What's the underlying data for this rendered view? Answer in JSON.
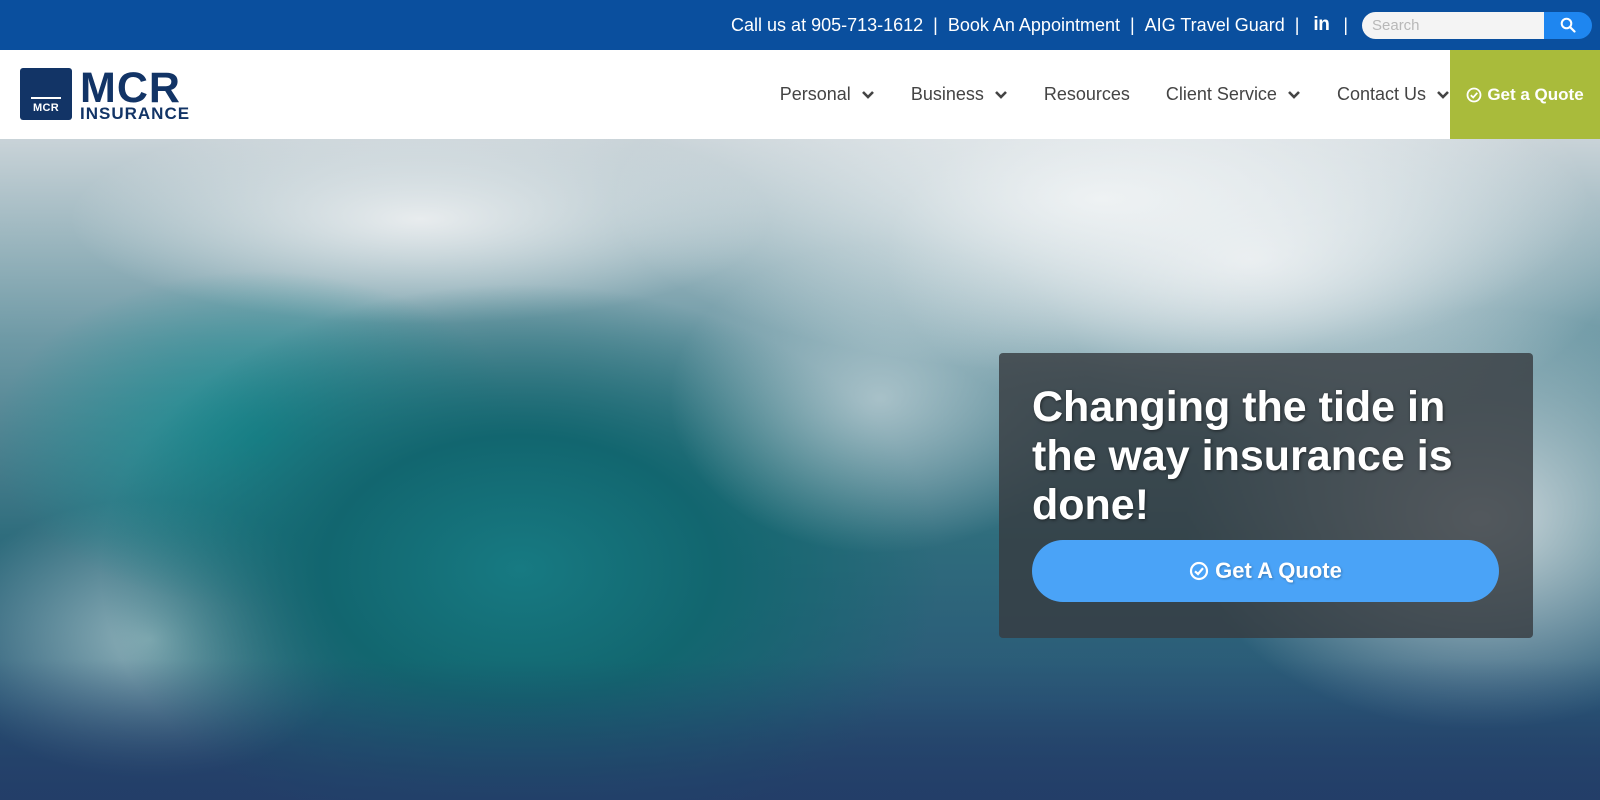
{
  "topbar": {
    "phone_text": "Call us at 905-713-1612",
    "separator": "|",
    "appointment_link": "Book An Appointment",
    "travel_link": "AIG Travel Guard",
    "linkedin_icon_text": "in",
    "search": {
      "placeholder": "Search",
      "value": ""
    }
  },
  "logo": {
    "box_text": "MCR",
    "word": "MCR",
    "sub": "INSURANCE"
  },
  "nav": {
    "items": [
      {
        "label": "Personal",
        "dropdown": true
      },
      {
        "label": "Business",
        "dropdown": true
      },
      {
        "label": "Resources",
        "dropdown": false
      },
      {
        "label": "Client Service",
        "dropdown": true
      },
      {
        "label": "Contact Us",
        "dropdown": true
      }
    ],
    "quote_button": "Get a Quote"
  },
  "hero": {
    "title": "Changing the tide in the way insurance is done!",
    "button_label": "Get A Quote"
  },
  "colors": {
    "topbar_bg": "#0a4f9e",
    "search_button": "#1e86f0",
    "logo_navy": "#123466",
    "quote_nav_bg": "#a9bb3b",
    "hero_button": "#4aa3f7",
    "hero_card_bg": "rgba(55,60,65,0.82)"
  },
  "icons": {
    "search": "search-icon",
    "linkedin": "linkedin-icon",
    "chevron": "chevron-down-icon",
    "check": "check-circle-icon"
  }
}
